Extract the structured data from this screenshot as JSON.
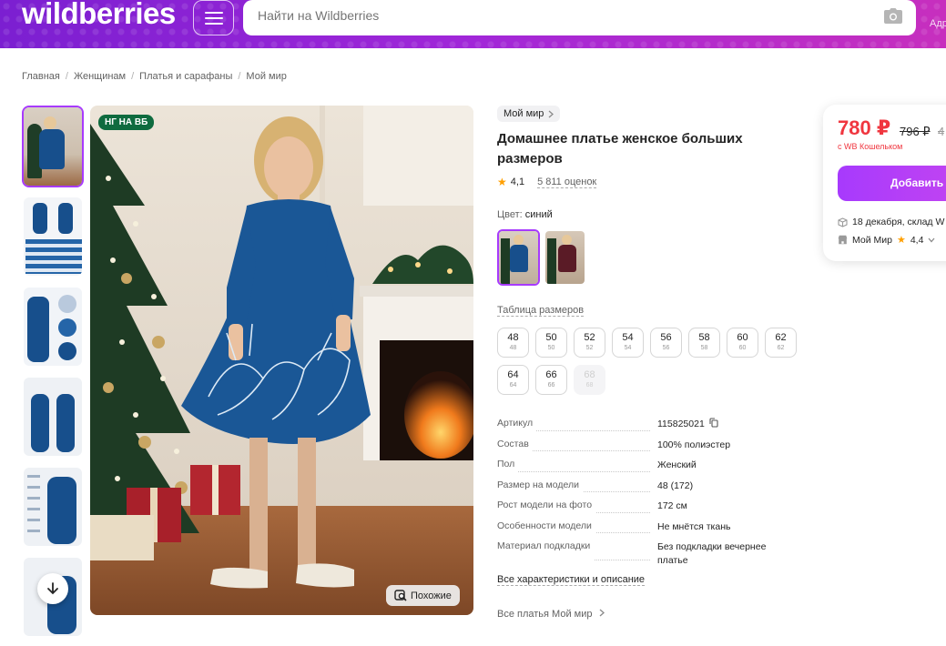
{
  "header": {
    "logo": "wildberries",
    "search_placeholder": "Найти на Wildberries",
    "address_label": "Адр"
  },
  "breadcrumb": [
    "Главная",
    "Женщинам",
    "Платья и сарафаны",
    "Мой мир"
  ],
  "gallery": {
    "badge": "НГ НА ВБ",
    "similar_label": "Похожие"
  },
  "product": {
    "brand": "Мой мир",
    "title": "Домашнее платье женское больших размеров",
    "rating": "4,1",
    "reviews": "5 811 оценок",
    "color_label": "Цвет:",
    "color_value": "синий",
    "size_table_label": "Таблица размеров",
    "sizes": [
      {
        "ru": "48",
        "sub": "48",
        "available": true
      },
      {
        "ru": "50",
        "sub": "50",
        "available": true
      },
      {
        "ru": "52",
        "sub": "52",
        "available": true
      },
      {
        "ru": "54",
        "sub": "54",
        "available": true
      },
      {
        "ru": "56",
        "sub": "56",
        "available": true
      },
      {
        "ru": "58",
        "sub": "58",
        "available": true
      },
      {
        "ru": "60",
        "sub": "60",
        "available": true
      },
      {
        "ru": "62",
        "sub": "62",
        "available": true
      },
      {
        "ru": "64",
        "sub": "64",
        "available": true
      },
      {
        "ru": "66",
        "sub": "66",
        "available": true
      },
      {
        "ru": "68",
        "sub": "68",
        "available": false
      }
    ],
    "specs": [
      {
        "key": "Артикул",
        "value": "115825021"
      },
      {
        "key": "Состав",
        "value": "100% полиэстер"
      },
      {
        "key": "Пол",
        "value": "Женский"
      },
      {
        "key": "Размер на модели",
        "value": "48 (172)"
      },
      {
        "key": "Рост модели на фото",
        "value": "172 см"
      },
      {
        "key": "Особенности модели",
        "value": "Не мнётся ткань"
      },
      {
        "key": "Материал подкладки",
        "value": "Без подкладки вечернее платье"
      }
    ],
    "all_characteristics": "Все характеристики и описание",
    "all_dresses": "Все платья Мой мир"
  },
  "price_card": {
    "price": "780 ₽",
    "old_price": "796 ₽",
    "old_price_2": "4",
    "wallet_note": "с WB Кошельком",
    "add_button": "Добавить",
    "delivery": "18 декабря, склад W",
    "seller_name": "Мой Мир",
    "seller_rating": "4,4"
  },
  "colors": {
    "accent": "#a73afd",
    "price_red": "#f0363f",
    "header_purple": "#a127d8"
  }
}
